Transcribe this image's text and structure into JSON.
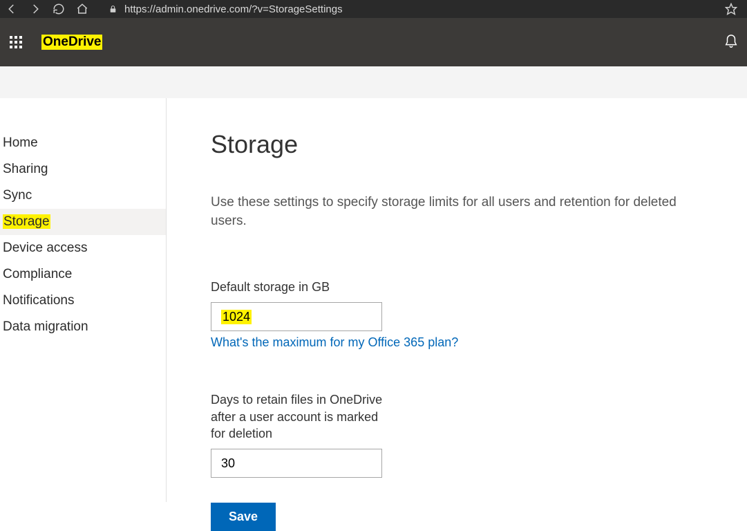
{
  "browser": {
    "url": "https://admin.onedrive.com/?v=StorageSettings"
  },
  "header": {
    "app_name": "OneDrive"
  },
  "sidebar": {
    "items": [
      {
        "label": "Home"
      },
      {
        "label": "Sharing"
      },
      {
        "label": "Sync"
      },
      {
        "label": "Storage"
      },
      {
        "label": "Device access"
      },
      {
        "label": "Compliance"
      },
      {
        "label": "Notifications"
      },
      {
        "label": "Data migration"
      }
    ],
    "active_index": 3
  },
  "main": {
    "title": "Storage",
    "description": "Use these settings to specify storage limits for all users and retention for deleted users.",
    "default_storage_label": "Default storage in GB",
    "default_storage_value": "1024",
    "help_link_text": "What's the maximum for my Office 365 plan?",
    "retention_label": "Days to retain files in OneDrive after a user account is marked for deletion",
    "retention_value": "30",
    "save_label": "Save"
  },
  "highlights": {
    "app_name": true,
    "sidebar_storage": true,
    "default_storage_value": true
  }
}
